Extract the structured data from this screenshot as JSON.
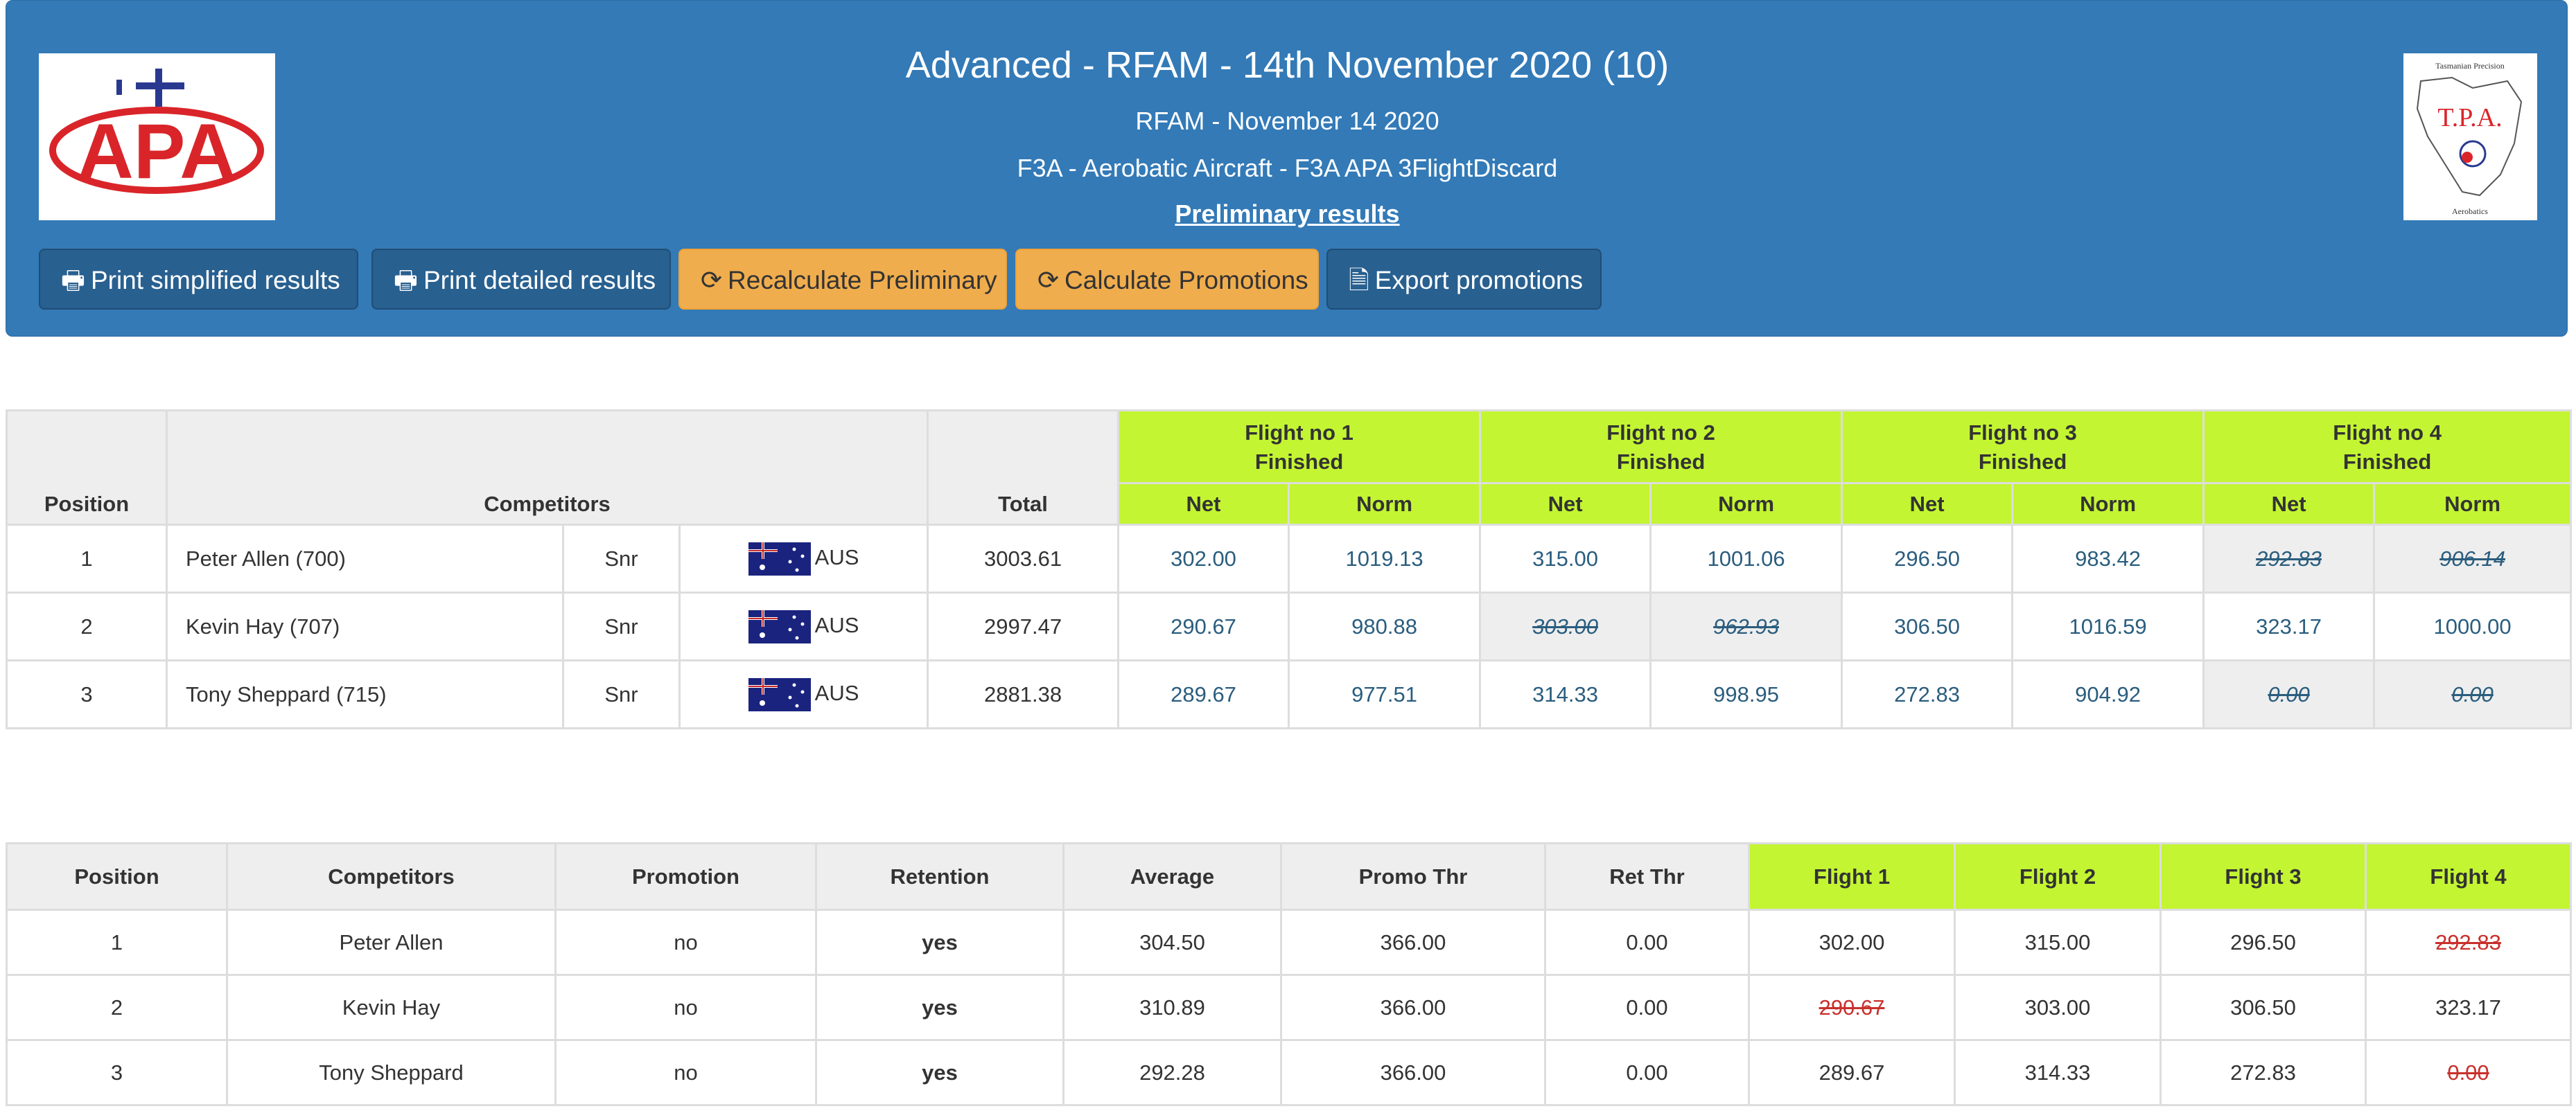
{
  "header": {
    "title": "Advanced - RFAM - 14th November 2020 (10)",
    "subtitle": "RFAM - November 14 2020",
    "class_line": "F3A - Aerobatic Aircraft - F3A APA 3FlightDiscard",
    "status": "Preliminary results",
    "logo_left_text": "APA",
    "logo_right": {
      "top": "Tasmanian Precision",
      "mid": "T.P.A.",
      "bottom": "Aerobatics"
    }
  },
  "buttons": {
    "print_simplified": "Print simplified results",
    "print_detailed": "Print detailed results",
    "recalc": "Recalculate Preliminary",
    "calc_promos": "Calculate Promotions",
    "export_promos": "Export promotions"
  },
  "results": {
    "headers": {
      "position": "Position",
      "competitors": "Competitors",
      "total": "Total",
      "net": "Net",
      "norm": "Norm"
    },
    "flights": [
      {
        "name": "Flight no 1",
        "status": "Finished"
      },
      {
        "name": "Flight no 2",
        "status": "Finished"
      },
      {
        "name": "Flight no 3",
        "status": "Finished"
      },
      {
        "name": "Flight no 4",
        "status": "Finished"
      }
    ],
    "rows": [
      {
        "pos": "1",
        "name": "Peter Allen (700)",
        "cat": "Snr",
        "country": "AUS",
        "total": "3003.61",
        "f": [
          [
            "302.00",
            "1019.13"
          ],
          [
            "315.00",
            "1001.06"
          ],
          [
            "296.50",
            "983.42"
          ],
          [
            "292.83",
            "906.14"
          ]
        ]
      },
      {
        "pos": "2",
        "name": "Kevin Hay (707)",
        "cat": "Snr",
        "country": "AUS",
        "total": "2997.47",
        "f": [
          [
            "290.67",
            "980.88"
          ],
          [
            "303.00",
            "962.93"
          ],
          [
            "306.50",
            "1016.59"
          ],
          [
            "323.17",
            "1000.00"
          ]
        ]
      },
      {
        "pos": "3",
        "name": "Tony Sheppard (715)",
        "cat": "Snr",
        "country": "AUS",
        "total": "2881.38",
        "f": [
          [
            "289.67",
            "977.51"
          ],
          [
            "314.33",
            "998.95"
          ],
          [
            "272.83",
            "904.92"
          ],
          [
            "0.00",
            "0.00"
          ]
        ]
      }
    ]
  },
  "promotions": {
    "headers": [
      "Position",
      "Competitors",
      "Promotion",
      "Retention",
      "Average",
      "Promo Thr",
      "Ret Thr",
      "Flight 1",
      "Flight 2",
      "Flight 3",
      "Flight 4"
    ],
    "rows": [
      {
        "pos": "1",
        "name": "Peter Allen",
        "promo": "no",
        "ret": "yes",
        "avg": "304.50",
        "pthr": "366.00",
        "rthr": "0.00",
        "f": [
          "302.00",
          "315.00",
          "296.50",
          "292.83"
        ]
      },
      {
        "pos": "2",
        "name": "Kevin Hay",
        "promo": "no",
        "ret": "yes",
        "avg": "310.89",
        "pthr": "366.00",
        "rthr": "0.00",
        "f": [
          "290.67",
          "303.00",
          "306.50",
          "323.17"
        ]
      },
      {
        "pos": "3",
        "name": "Tony Sheppard",
        "promo": "no",
        "ret": "yes",
        "avg": "292.28",
        "pthr": "366.00",
        "rthr": "0.00",
        "f": [
          "289.67",
          "314.33",
          "272.83",
          "0.00"
        ]
      }
    ]
  },
  "colors": {
    "header_bg": "#337ab7",
    "flight_header": "#c3f532",
    "button_dark": "#286090",
    "button_orange": "#f0ad4e"
  }
}
